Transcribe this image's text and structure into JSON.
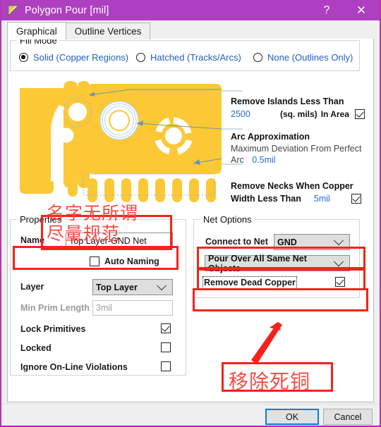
{
  "window": {
    "title": "Polygon Pour [mil]",
    "icon": "polygon-pour-icon",
    "help_label": "?",
    "close_label": "✕",
    "accent_color": "#ad3fc0",
    "border_color": "#d300d3"
  },
  "tabs": [
    {
      "label": "Graphical",
      "active": true
    },
    {
      "label": "Outline Vertices",
      "active": false
    }
  ],
  "fill_mode": {
    "group_label": "Fill Mode",
    "options": [
      {
        "label": "Solid (Copper Regions)",
        "selected": true
      },
      {
        "label": "Hatched (Tracks/Arcs)",
        "selected": false
      },
      {
        "label": "None (Outlines Only)",
        "selected": false
      }
    ],
    "label_color": "#1f5fbf"
  },
  "callouts": {
    "remove_islands": {
      "title": "Remove Islands Less Than",
      "value": "2500",
      "units": "(sq. mils)",
      "suffix": "In Area",
      "checked": true
    },
    "arc_approximation": {
      "title": "Arc Approximation",
      "description": "Maximum Deviation From Perfect",
      "arc_label": "Arc",
      "value": "0.5mil"
    },
    "remove_necks": {
      "title": "Remove Necks When Copper",
      "subtitle": "Width Less Than",
      "value": "5mil",
      "checked": true
    }
  },
  "properties": {
    "group_label": "Properties",
    "name_label": "Name",
    "name_value": "Top Layer-GND Net",
    "auto_naming_label": "Auto Naming",
    "auto_naming_checked": false,
    "layer_label": "Layer",
    "layer_value": "Top Layer",
    "min_prim_length_label": "Min Prim Length",
    "min_prim_length_value": "3mil",
    "lock_primitives_label": "Lock Primitives",
    "lock_primitives_checked": true,
    "locked_label": "Locked",
    "locked_checked": false,
    "ignore_violations_label": "Ignore On-Line Violations",
    "ignore_violations_checked": false
  },
  "net_options": {
    "group_label": "Net Options",
    "connect_to_net_label": "Connect to Net",
    "connect_to_net_value": "GND",
    "pour_over_value": "Pour Over All Same Net Objects",
    "remove_dead_copper_label": "Remove Dead Copper",
    "remove_dead_copper_checked": true
  },
  "annotations": {
    "note_top_line1": "名字无所谓",
    "note_top_line2": "尽量规范",
    "note_bottom": "移除死铜",
    "highlight_color": "#f4231c",
    "text_color": "#fb4a43"
  },
  "footer": {
    "ok_label": "OK",
    "cancel_label": "Cancel"
  }
}
